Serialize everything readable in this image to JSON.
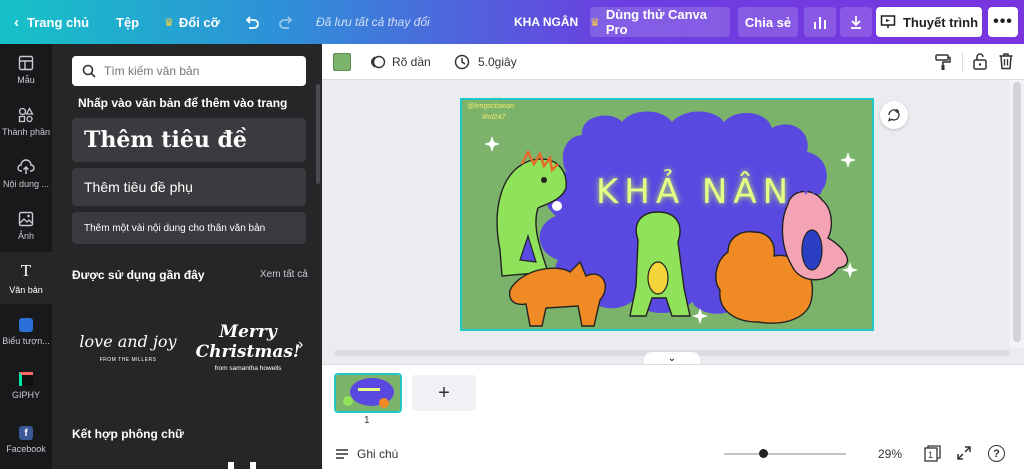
{
  "topbar": {
    "home": "Trang chủ",
    "file": "Tệp",
    "resize": "Đổi cỡ",
    "saved_status": "Đã lưu tất cả thay đổi",
    "design_title": "KHA NGÂN",
    "try_pro": "Dùng thử Canva Pro",
    "share": "Chia sẻ",
    "present": "Thuyết trình"
  },
  "nav": {
    "items": [
      {
        "label": "Mẫu"
      },
      {
        "label": "Thành phần"
      },
      {
        "label": "Nội dung ..."
      },
      {
        "label": "Ảnh"
      },
      {
        "label": "Văn bản"
      },
      {
        "label": "Biểu tượn..."
      },
      {
        "label": "GIPHY"
      },
      {
        "label": "Facebook"
      }
    ]
  },
  "panel": {
    "search_placeholder": "Tìm kiếm văn bản",
    "hint": "Nhấp vào văn bản để thêm vào trang",
    "add_heading": "Thêm tiêu đề",
    "add_subheading": "Thêm tiêu đề phụ",
    "add_body": "Thêm một vài nội dung cho thân văn bản",
    "recent_title": "Được sử dụng gần đây",
    "see_all": "Xem tất cả",
    "font_combo_title": "Kết hợp phông chữ",
    "recent_items": [
      {
        "main": "love and joy",
        "sub": "FROM THE MILLERS"
      },
      {
        "main1": "Merry",
        "main2": "Christmas!",
        "sub": "from samantha howells"
      }
    ]
  },
  "toolbar": {
    "color": "#7cb36b",
    "transition": "Rõ dần",
    "duration": "5.0giây"
  },
  "canvas": {
    "title_text": "KHẢ NÂN",
    "handle1": "@lengocbaoan",
    "handle2": "#hd247",
    "bg_color": "#7cb36b",
    "cloud_color": "#5a49e0"
  },
  "pages": {
    "page_number": "1"
  },
  "footer": {
    "notes": "Ghi chú",
    "zoom": "29%",
    "page_count": "1",
    "zoom_fraction": 0.29
  }
}
